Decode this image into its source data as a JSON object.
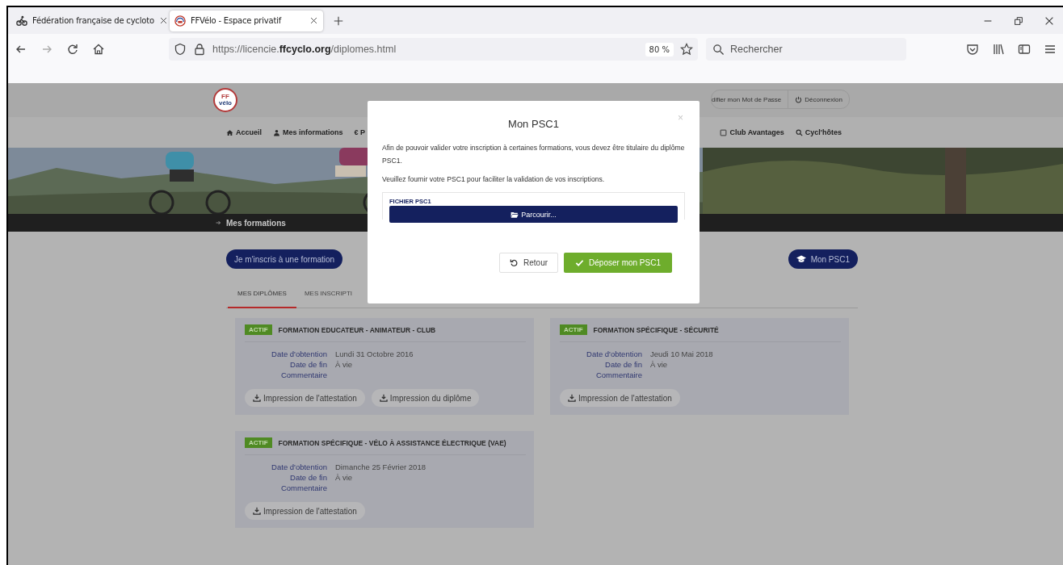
{
  "browser": {
    "tabs": [
      {
        "label": "Fédération française de cycloto",
        "selected": false,
        "kind": "bike"
      },
      {
        "label": "FFVélo - Espace privatif",
        "selected": true,
        "kind": "logo"
      }
    ],
    "url": "https://licencie.**ffcyclo.org**/diplomes.html",
    "zoom": "80 %",
    "search": {
      "placeholder": "Rechercher"
    }
  },
  "site": {
    "logo": "FF vélo",
    "user_links": [
      {
        "label": "difier mon Mot de Passe",
        "kind": "key"
      },
      {
        "label": "Déconnexion",
        "kind": "power"
      }
    ],
    "nav": [
      {
        "label": "Accueil",
        "kind": "home"
      },
      {
        "label": "Mes informations",
        "kind": "user"
      },
      {
        "label": "€ P",
        "kind": "none"
      },
      {
        "label": "Club Avantages",
        "kind": "card"
      },
      {
        "label": "Cycl'hôtes",
        "kind": "search"
      }
    ],
    "breadcrumb": "Mes formations",
    "register_button": "Je m'inscris à une formation",
    "psc1_button": "Mon PSC1",
    "tabs": [
      {
        "label": "MES DIPLÔMES",
        "selected": true
      },
      {
        "label": "MES INSCRIPTI",
        "selected": false
      }
    ],
    "diplomas": [
      {
        "status": "ACTIF",
        "title": "FORMATION EDUCATEUR - ANIMATEUR - CLUB",
        "fields": [
          {
            "label": "Date d'obtention",
            "value": "Lundi 31 Octobre 2016"
          },
          {
            "label": "Date de fin",
            "value": "À vie"
          },
          {
            "label": "Commentaire"
          }
        ],
        "buttons": [
          "Impression de l'attestation",
          "Impression du diplôme"
        ]
      },
      {
        "status": "ACTIF",
        "title": "FORMATION SPÉCIFIQUE - SÉCURITÉ",
        "fields": [
          {
            "label": "Date d'obtention",
            "value": "Jeudi 10 Mai 2018"
          },
          {
            "label": "Date de fin",
            "value": "À vie"
          },
          {
            "label": "Commentaire"
          }
        ],
        "buttons": [
          "Impression de l'attestation"
        ]
      },
      {
        "status": "ACTIF",
        "title": "FORMATION SPÉCIFIQUE - VÉLO À ASSISTANCE ÉLECTRIQUE (VAE)",
        "fields": [
          {
            "label": "Date d'obtention",
            "value": "Dimanche 25 Février 2018"
          },
          {
            "label": "Date de fin",
            "value": "À vie"
          },
          {
            "label": "Commentaire"
          }
        ],
        "buttons": [
          "Impression de l'attestation"
        ]
      }
    ]
  },
  "modal": {
    "title": "Mon PSC1",
    "close": "×",
    "paragraphs": [
      "Afin de pouvoir valider votre inscription à certaines formations, vous devez être titulaire du diplôme PSC1.",
      "Veuillez fournir votre PSC1 pour faciliter la validation de vos inscriptions."
    ],
    "file_label": "FICHIER PSC1",
    "browse_button": "Parcourir...",
    "buttons": [
      {
        "label": "Retour",
        "kind": "back"
      },
      {
        "label": "Déposer mon PSC1",
        "kind": "submit"
      }
    ]
  }
}
